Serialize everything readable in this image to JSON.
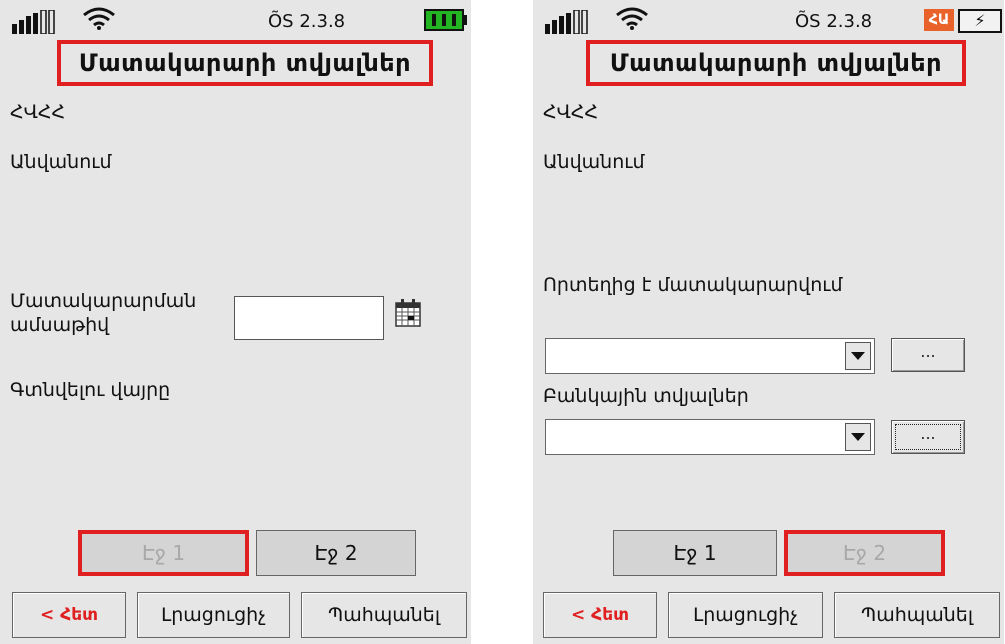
{
  "status_bar": {
    "os_version": "ÕS 2.3.8",
    "lang_badge": "ՀԱ",
    "charge_symbol": "⚡"
  },
  "screen1": {
    "title": "Մատակարարի տվյալներ",
    "field_hvhh": "ՀՎՀՀ",
    "field_name": "Անվանում",
    "field_date": "Մատակարարման ամսաթիվ",
    "field_location": "Գտնվելու վայրը",
    "page1": "Էջ 1",
    "page2": "Էջ 2",
    "back": "< Հետ",
    "fill": "Լրացուցիչ",
    "save": "Պահպանել"
  },
  "screen2": {
    "title": "Մատակարարի տվյալներ",
    "field_hvhh": "ՀՎՀՀ",
    "field_name": "Անվանում",
    "field_from_where": "Որտեղից է մատակարարվում",
    "ellipsis": "...",
    "field_bank": "Բանկային տվյալներ",
    "page1": "Էջ 1",
    "page2": "Էջ 2",
    "back": "< Հետ",
    "fill": "Լրացուցիչ",
    "save": "Պահպանել"
  },
  "colors": {
    "highlight": "#e02020",
    "background": "#e6e6e6",
    "battery": "#22b722",
    "lang_badge": "#e8622a"
  }
}
